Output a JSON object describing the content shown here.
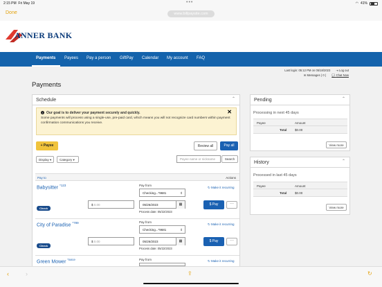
{
  "status_bar": {
    "time": "2:15 PM",
    "date": "Fri May 19",
    "battery": "41%"
  },
  "browser": {
    "done_label": "Done",
    "url": "www.billpaysite.com"
  },
  "brand": {
    "name": "ANNER BANK"
  },
  "nav": {
    "items": [
      "Payments",
      "Payees",
      "Pay a person",
      "GiftPay",
      "Calendar",
      "My account",
      "FAQ"
    ]
  },
  "session": {
    "last_login": "Last login: 05:12 PM on 05/18/2023",
    "logout": "Log out",
    "messages": "Messages ( 0 )",
    "chat": "Chat Now"
  },
  "page_title": "Payments",
  "schedule": {
    "title": "Schedule",
    "notice_title": "Our goal is to deliver your payment securely and quickly.",
    "notice_body": "Some payments will process using a single-use, pre-paid card, which means you will not recognize card numbers within payment confirmation communications you receive.",
    "add_payee": "+ Payee",
    "review_all": "Review all",
    "pay_all": "Pay all",
    "display_filter": "Display",
    "category_filter": "Category",
    "search_placeholder": "Payee name or nickname",
    "search_button": "Search",
    "pay_to_header": "Pay to",
    "actions_header": "Actions",
    "pay_from_label": "Pay from",
    "recurring_label": "Make it recurring",
    "pay_button": "$ Pay",
    "amount_placeholder": "0.00",
    "currency": "$",
    "payees": [
      {
        "name": "Babysitter",
        "suffix": "*123",
        "method": "Check",
        "account": "Checking...*9681",
        "date": "05/26/2023",
        "process_date": "Process date: 05/22/2023"
      },
      {
        "name": "City of Paradise",
        "suffix": "*789",
        "method": "Check",
        "account": "Checking...*9681",
        "date": "05/26/2023",
        "process_date": "Process date: 05/22/2023"
      },
      {
        "name": "Green Mower",
        "suffix": "*ance",
        "method": "",
        "account": "Checking...*9681",
        "date": "",
        "process_date": ""
      }
    ]
  },
  "pending": {
    "title": "Pending",
    "subtitle": "Processing in next 45 days",
    "col_payee": "Payee",
    "col_amount": "Amount",
    "total_label": "Total",
    "total_value": "$0.00",
    "view_more": "View more"
  },
  "history": {
    "title": "History",
    "subtitle": "Processed in last 45 days",
    "col_payee": "Payee",
    "col_amount": "Amount",
    "total_label": "Total",
    "total_value": "$0.00",
    "view_more": "View more"
  }
}
